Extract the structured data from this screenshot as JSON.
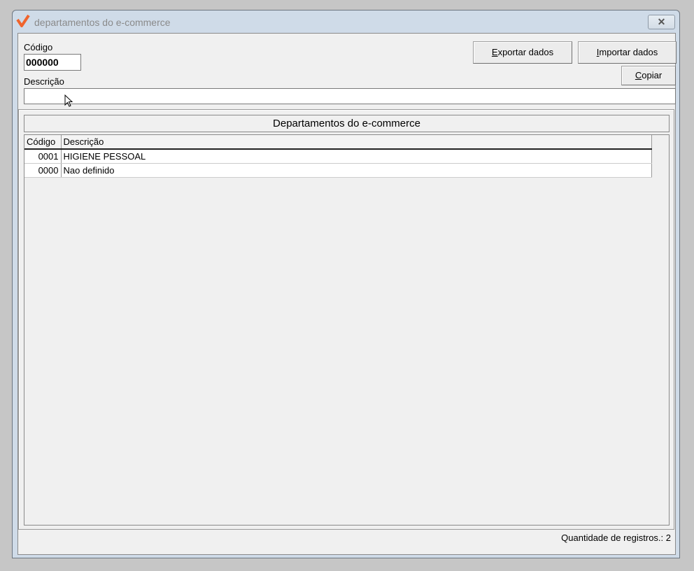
{
  "window": {
    "title": "departamentos do e-commerce",
    "close_label": "✕"
  },
  "form": {
    "codigo_label": "Código",
    "codigo_value": "000000",
    "descricao_label": "Descrição",
    "descricao_value": ""
  },
  "buttons": {
    "exportar": {
      "accel": "E",
      "rest": "xportar dados"
    },
    "importar": {
      "accel": "I",
      "rest": "mportar dados"
    },
    "copiar": {
      "accel": "C",
      "rest": "opiar"
    }
  },
  "grid": {
    "title": "Departamentos do e-commerce",
    "columns": [
      "Código",
      "Descrição"
    ],
    "rows": [
      {
        "codigo": "0001",
        "descricao": "HIGIENE PESSOAL"
      },
      {
        "codigo": "0000",
        "descricao": "Nao definido"
      }
    ]
  },
  "status": {
    "text": "Quantidade de registros.: 2"
  },
  "colors": {
    "accent": "#f0642d"
  }
}
